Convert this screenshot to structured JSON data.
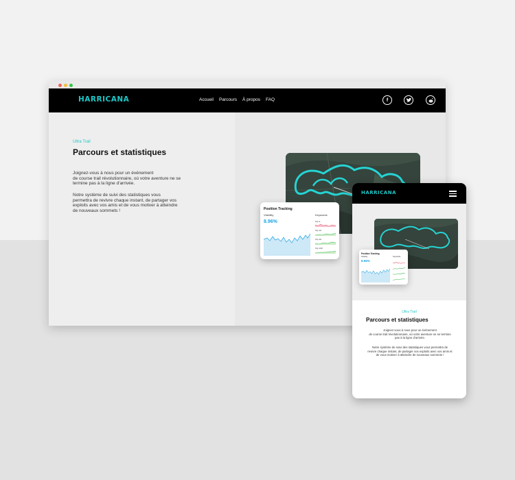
{
  "brand": {
    "name": "HARRICANA",
    "accent": "#1ec6c6"
  },
  "nav": {
    "links": [
      "Accueil",
      "Parcours",
      "À propos",
      "FAQ"
    ],
    "social": [
      "facebook-icon",
      "twitter-icon",
      "reddit-icon"
    ]
  },
  "hero": {
    "eyebrow": "Ultra Trail",
    "title": "Parcours et statistiques",
    "p1_line1": "Joignez-vous à nous pour un événement",
    "p1_line2": "de course trail révolutionnaire, où votre aventure ne se",
    "p1_line3": "termine pas à la ligne d'arrivée.",
    "p2_line1": "Notre système de suivi des statistiques vous",
    "p2_line2": "permettra de revivre chaque instant, de partager vos",
    "p2_line3": "exploits avec vos amis et de vous motiver à atteindre",
    "p2_line4": "de nouveaux sommets !"
  },
  "tracking_card": {
    "title": "Position Tracking",
    "metric_label": "Visibility",
    "metric_value": "8.96%",
    "keywords_label": "Keywords",
    "rows": [
      "Top 3",
      "Top 10",
      "Top 20",
      "Top 100"
    ]
  },
  "mobile": {
    "p1_line1": "Joignez-vous à nous pour un événement",
    "p1_line2": "de course trail révolutionnaire, où votre aventure ne se termine",
    "p1_line3": "pas à la ligne d'arrivée.",
    "p2_line1": "Notre système de suivi des statistiques vous permettra de",
    "p2_line2": "revivre chaque instant, de partager vos exploits avec vos amis et",
    "p2_line3": "de vous motiver à atteindre de nouveaux sommets !"
  }
}
